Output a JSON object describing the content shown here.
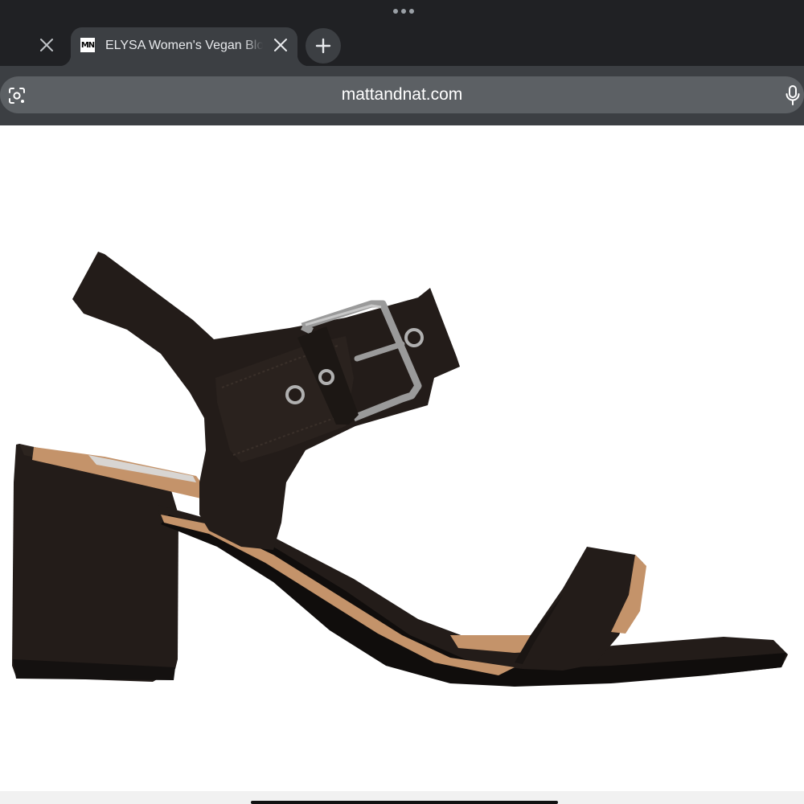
{
  "browser": {
    "tabs": [
      {
        "label": "",
        "active": false
      },
      {
        "favicon_text": "MN",
        "label": "ELYSA Women's Vegan Block Heel Sandal",
        "active": true
      }
    ],
    "address_bar": {
      "url": "mattandnat.com"
    },
    "icons": {
      "grabber": "more-dots-icon",
      "close": "close-icon",
      "new_tab": "plus-icon",
      "lens": "camera-search-icon",
      "mic": "microphone-icon"
    }
  },
  "content": {
    "product_image": {
      "alt": "Black vegan suede block heel sandal with buckle ankle strap"
    }
  },
  "colors": {
    "tab_strip": "#202124",
    "toolbar": "#3c3f43",
    "omnibox": "#5c6064",
    "sandal": "#231c19",
    "buckle": "#9a9a9a",
    "insole": "#c4936a"
  }
}
